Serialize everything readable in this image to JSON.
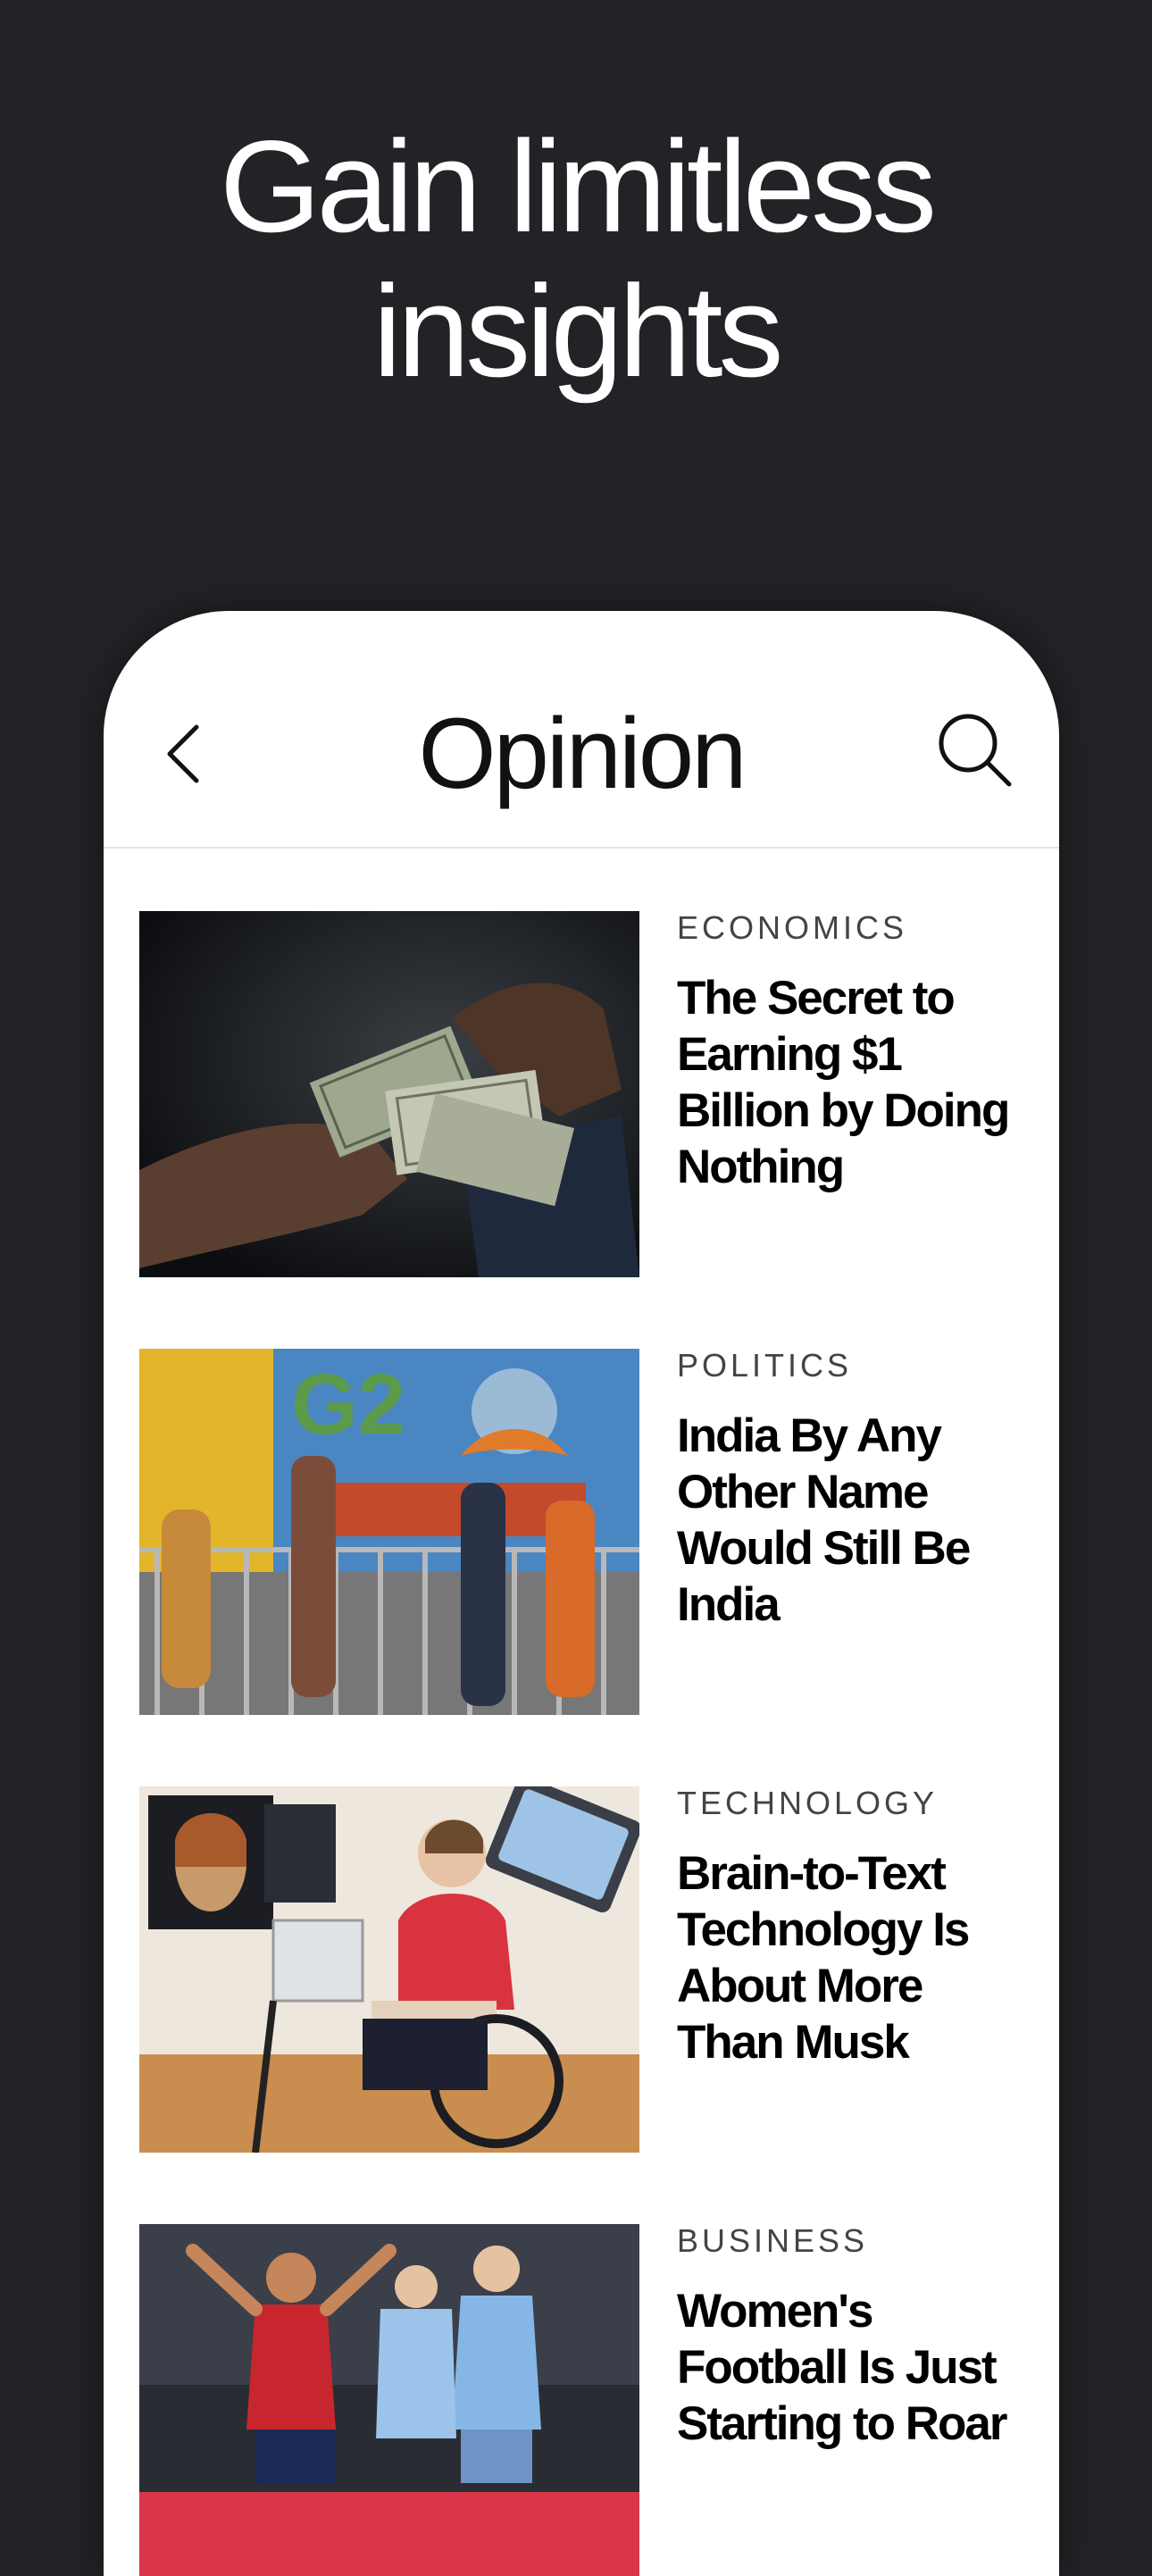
{
  "promo": {
    "headline_line1": "Gain limitless",
    "headline_line2": "insights"
  },
  "nav": {
    "title": "Opinion",
    "back_icon": "chevron-left-icon",
    "search_icon": "search-icon"
  },
  "articles": [
    {
      "category": "ECONOMICS",
      "title": "The Secret to Earning $1 Billion by Doing Nothing"
    },
    {
      "category": "POLITICS",
      "title": "India By Any Other Name Would Still Be India"
    },
    {
      "category": "TECHNOLOGY",
      "title": "Brain-to-Text Technology Is About More Than Musk"
    },
    {
      "category": "BUSINESS",
      "title": "Women's Football Is Just Starting to Roar"
    }
  ],
  "colors": {
    "background": "#222326",
    "card": "#ffffff",
    "text": "#000000",
    "category": "#444444"
  }
}
